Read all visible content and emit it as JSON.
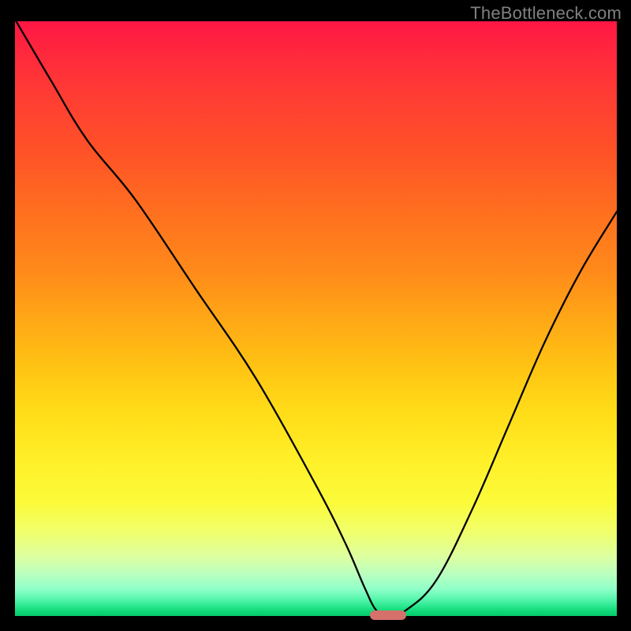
{
  "watermark": "TheBottleneck.com",
  "chart_data": {
    "type": "line",
    "title": "",
    "xlabel": "",
    "ylabel": "",
    "xlim": [
      0,
      100
    ],
    "ylim": [
      0,
      100
    ],
    "series": [
      {
        "name": "bottleneck-curve",
        "x": [
          0.2,
          6,
          12,
          20,
          30,
          40,
          50,
          55,
          58,
          60,
          62,
          65,
          70,
          76,
          82,
          88,
          94,
          100
        ],
        "values": [
          100,
          90,
          80,
          70,
          55,
          40,
          22,
          12,
          5,
          1,
          0,
          1,
          6,
          18,
          32,
          46,
          58,
          68
        ]
      }
    ],
    "marker": {
      "x": 62,
      "y": 0,
      "width_pct": 6
    },
    "gradient_stops": [
      {
        "pct": 0,
        "color": "#ff1744"
      },
      {
        "pct": 50,
        "color": "#ffa716"
      },
      {
        "pct": 80,
        "color": "#fbfb3a"
      },
      {
        "pct": 100,
        "color": "#05c96b"
      }
    ]
  }
}
